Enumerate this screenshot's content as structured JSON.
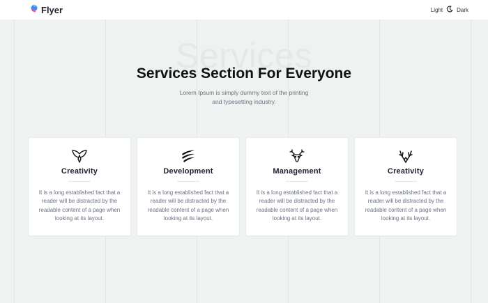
{
  "header": {
    "brand_name": "Flyer",
    "theme_light_label": "Light",
    "theme_dark_label": "Dark",
    "logo_icon": "flyer-logo-icon",
    "theme_icon": "moon-icon"
  },
  "hero": {
    "watermark": "Services",
    "title": "Services Section For Everyone",
    "subtitle": "Lorem Ipsum is simply dummy text of the printing and typesetting industry."
  },
  "cards": [
    {
      "icon": "wings-icon",
      "title": "Creativity",
      "text": "It is a long established fact that a reader will be distracted by the readable content of a page when looking at its layout."
    },
    {
      "icon": "strokes-icon",
      "title": "Development",
      "text": "It is a long established fact that a reader will be distracted by the readable content of a page when looking at its layout."
    },
    {
      "icon": "deer-head-icon",
      "title": "Management",
      "text": "It is a long established fact that a reader will be distracted by the readable content of a page when looking at its layout."
    },
    {
      "icon": "antlers-icon",
      "title": "Creativity",
      "text": "It is a long established fact that a reader will be distracted by the readable content of a page when looking at its layout."
    }
  ],
  "colors": {
    "background": "#eef3f1",
    "card": "#ffffff",
    "logo_blue": "#3f8cf0",
    "logo_pink": "#f3518a"
  }
}
